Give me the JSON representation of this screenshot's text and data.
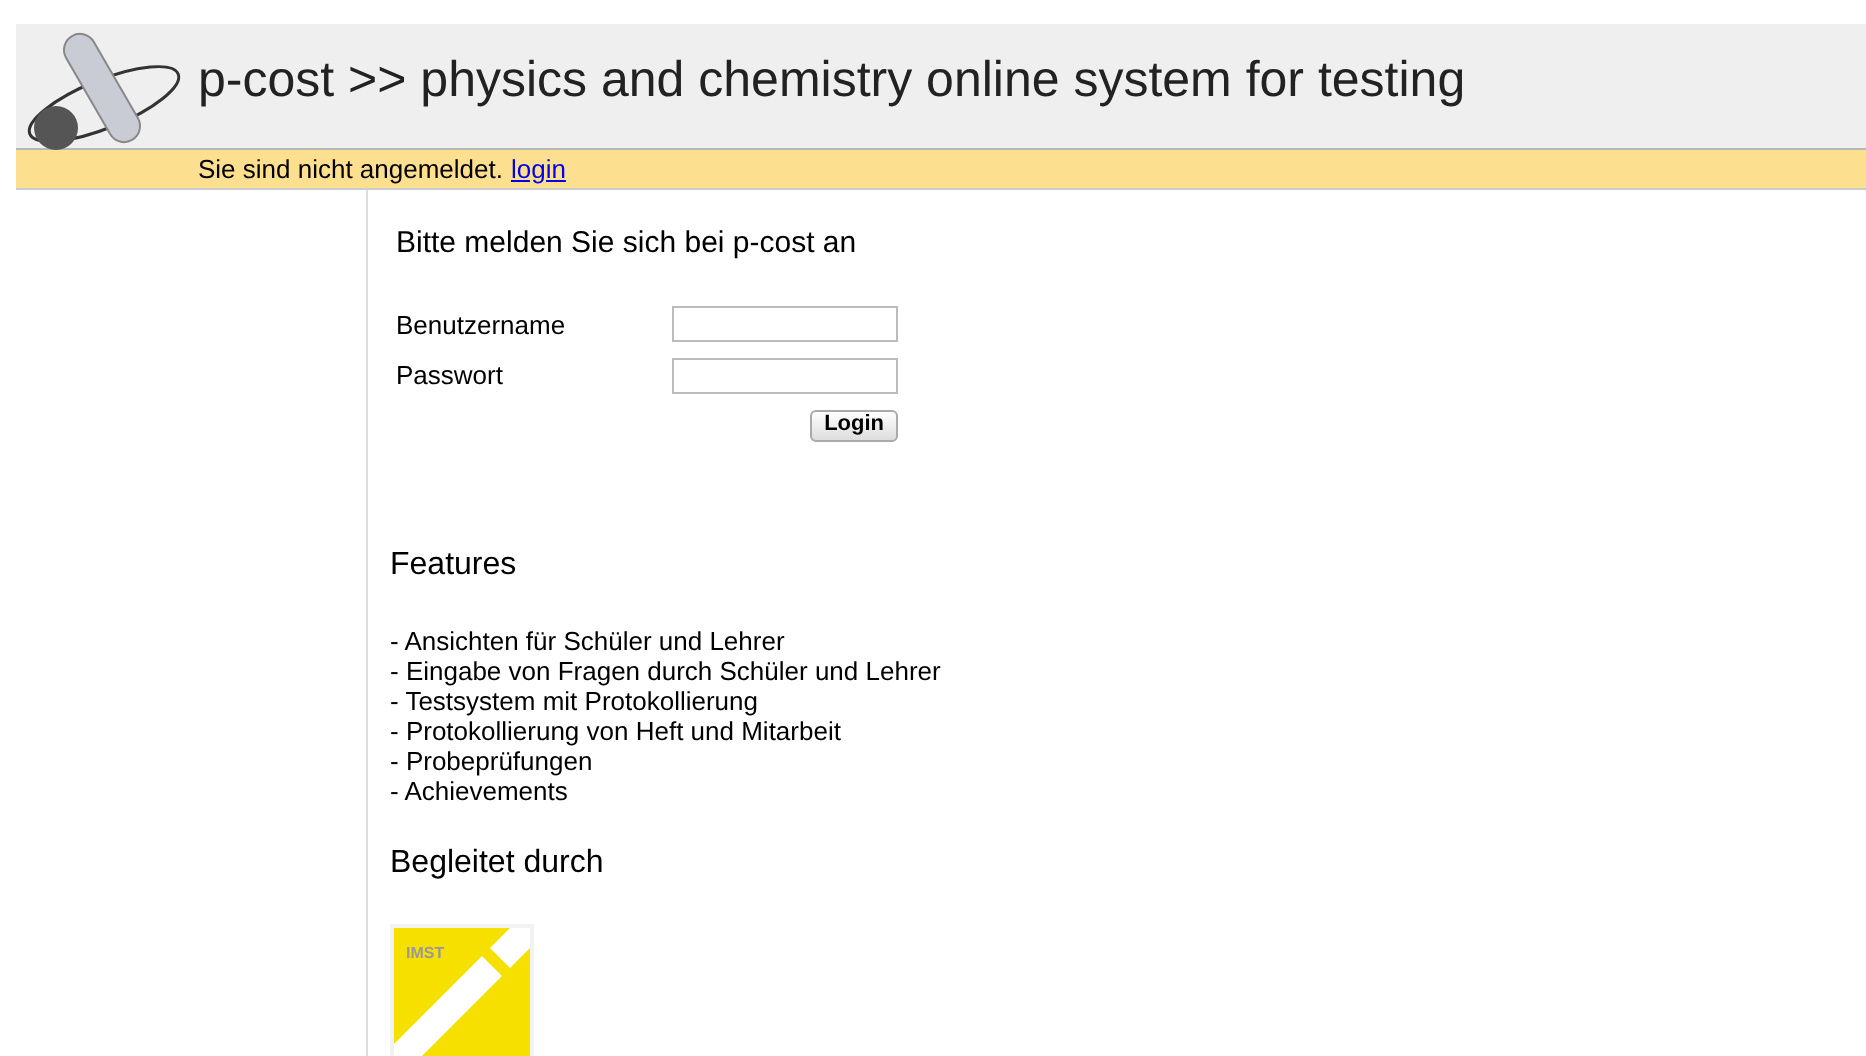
{
  "header": {
    "title": "p-cost >> physics and chemistry online system for testing",
    "status": "Sie sind nicht angemeldet.",
    "login_link": "login"
  },
  "login_form": {
    "heading": "Bitte melden Sie sich bei p-cost an",
    "fields": [
      {
        "label": "Benutzername"
      },
      {
        "label": "Passwort"
      }
    ],
    "button": "Login"
  },
  "features": {
    "heading": "Features",
    "items": [
      "- Ansichten für Schüler und Lehrer",
      "- Eingabe von Fragen durch Schüler und Lehrer",
      "- Testsystem mit Protokollierung",
      "- Protokollierung von Heft und Mitarbeit",
      "- Probeprüfungen",
      "- Achievements"
    ]
  },
  "partners": {
    "heading": "Begleitet durch",
    "logo_text": "IMST"
  }
}
